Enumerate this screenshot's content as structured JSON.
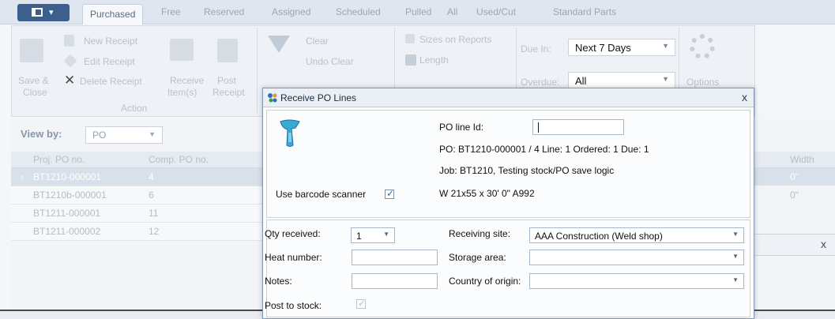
{
  "app": {
    "menu_arrow": "▾",
    "tabs": [
      "Purchased",
      "Free",
      "Reserved",
      "Assigned",
      "Scheduled",
      "Pulled",
      "All",
      "Used/Cut",
      "Standard Parts"
    ],
    "ribbon": {
      "save_close_1": "Save &",
      "save_close_2": "Close",
      "new_receipt": "New Receipt",
      "edit_receipt": "Edit Receipt",
      "delete_receipt": "Delete Receipt",
      "receive_items_1": "Receive",
      "receive_items_2": "Item(s)",
      "post_receipt_1": "Post",
      "post_receipt_2": "Receipt",
      "action_group": "Action",
      "clear": "Clear",
      "undo_clear": "Undo Clear",
      "sizes_on_reports": "Sizes on Reports",
      "length": "Length",
      "due_in_label": "Due In:",
      "due_in_value": "Next 7 Days",
      "overdue_label": "Overdue:",
      "overdue_value": "All",
      "options": "Options"
    },
    "view_by_label": "View by:",
    "view_by_value": "PO",
    "grid": {
      "headers": [
        "Proj. PO no.",
        "Comp. PO no."
      ],
      "width_header": "Width",
      "rows": [
        {
          "proj": "BT1210-000001",
          "comp": "4",
          "width": "0\""
        },
        {
          "proj": "BT1210b-000001",
          "comp": "6",
          "width": "0\""
        },
        {
          "proj": "BT1211-000001",
          "comp": "11"
        },
        {
          "proj": "BT1211-000002",
          "comp": "12"
        }
      ]
    },
    "side_panel_close": "x"
  },
  "dialog": {
    "title": "Receive PO Lines",
    "close": "x",
    "po_line_id_label": "PO line Id:",
    "po_line_id_value": "",
    "po_info": "PO: BT1210-000001 / 4  Line: 1   Ordered: 1  Due: 1",
    "job_info": "Job:  BT1210, Testing stock/PO save logic",
    "material": "W 21x55 x 30' 0\"  A992",
    "use_barcode_label": "Use barcode scanner",
    "qty_received_label": "Qty received:",
    "qty_received_value": "1",
    "heat_number_label": "Heat number:",
    "notes_label": "Notes:",
    "post_to_stock_label": "Post to stock:",
    "receiving_site_label": "Receiving site:",
    "receiving_site_value": "AAA Construction (Weld shop)",
    "storage_area_label": "Storage area:",
    "storage_area_value": "",
    "country_label": "Country of origin:",
    "country_value": ""
  }
}
